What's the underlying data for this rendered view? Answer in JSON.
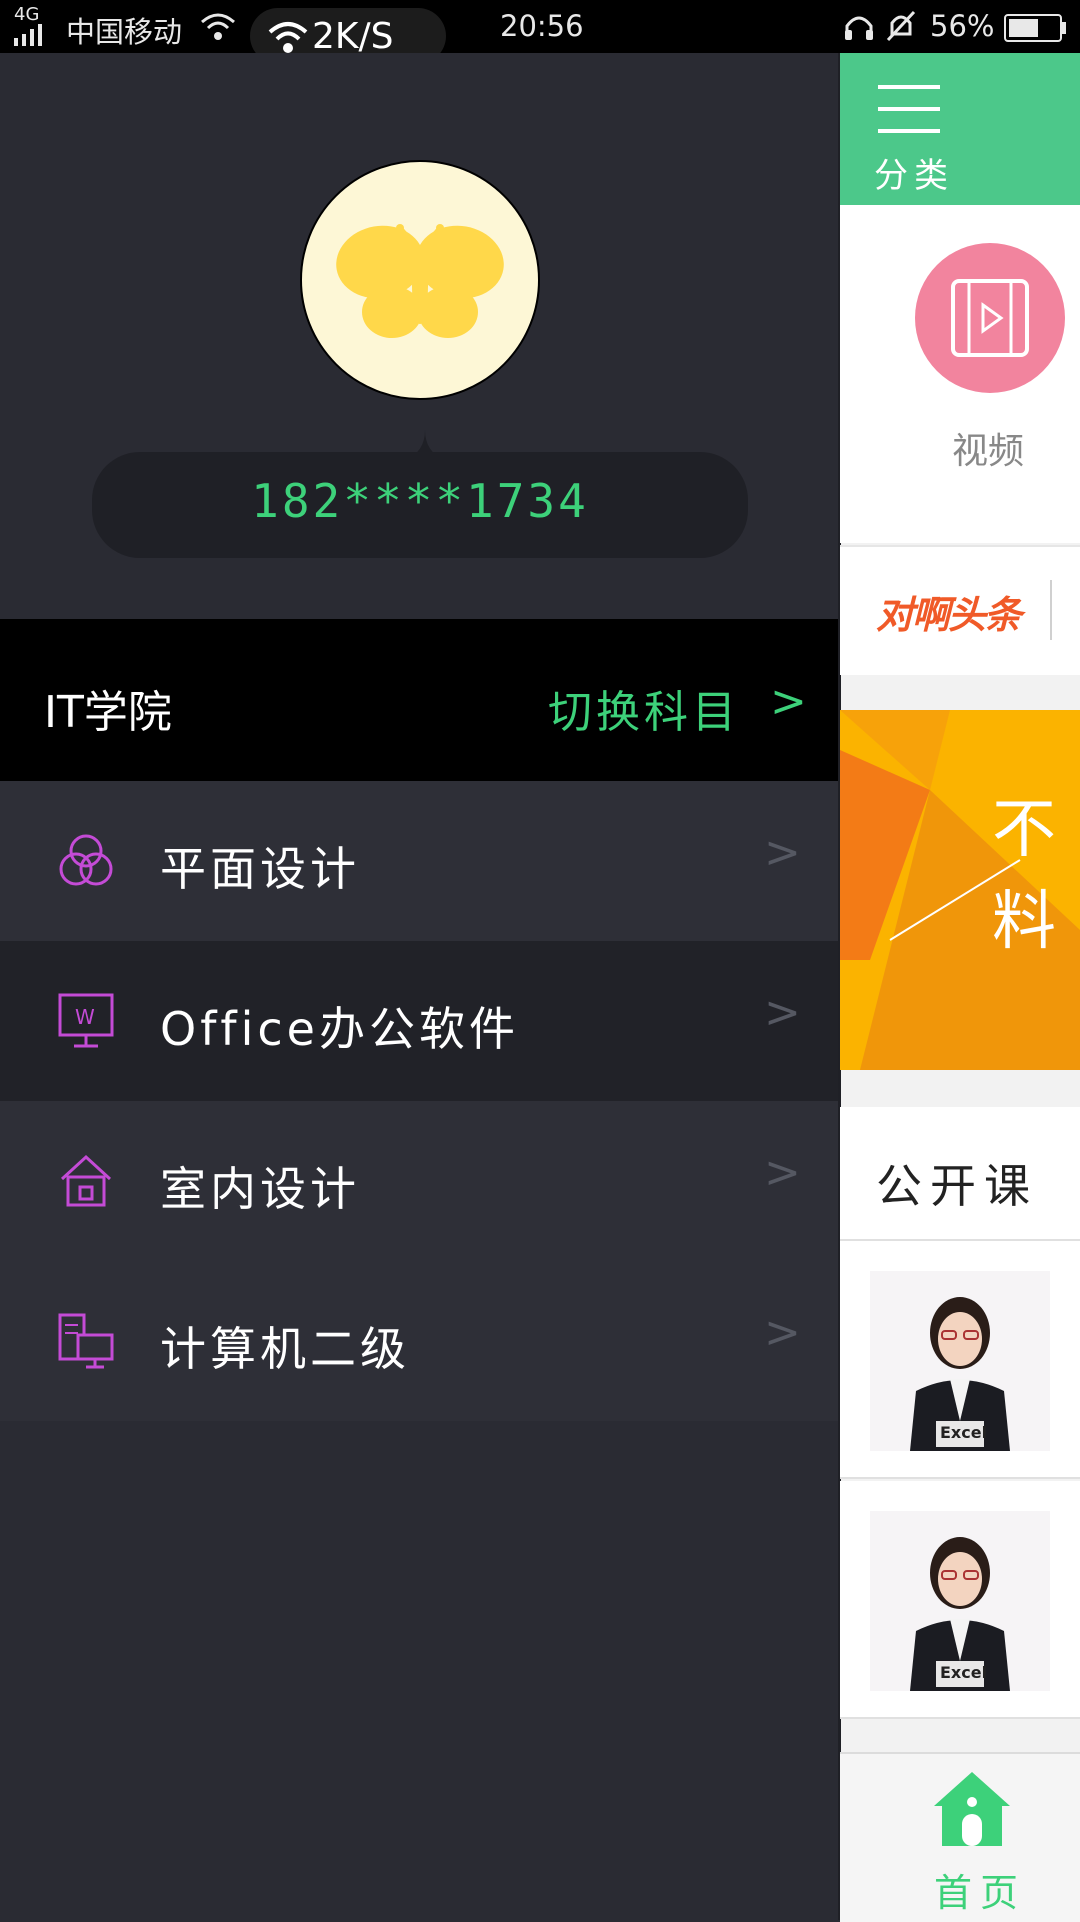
{
  "status_bar": {
    "network_type": "4G",
    "carrier": "中国移动",
    "net_speed": "2K/S",
    "time": "20:56",
    "battery": "56%",
    "battery_level": 0.56
  },
  "profile": {
    "phone": "182****1734"
  },
  "college": {
    "name": "IT学院",
    "switch_label": "切换科目",
    "switch_chevron": ">"
  },
  "menu": [
    {
      "label": "平面设计",
      "icon": "circles-icon"
    },
    {
      "label": "Office办公软件",
      "icon": "monitor-w-icon"
    },
    {
      "label": "室内设计",
      "icon": "house-icon"
    },
    {
      "label": "计算机二级",
      "icon": "computer-icon"
    }
  ],
  "menu_chevron": ">",
  "peek": {
    "category_label": "分类",
    "video_label": "视频",
    "news_logo": "对啊头条",
    "banner_text": "不料",
    "open_course_label": "公开课",
    "home_label": "首页",
    "course_badge": "Excel"
  },
  "colors": {
    "accent_green": "#3dd17a",
    "drawer_bg": "#2a2b33",
    "icon_purple": "#c44bd6",
    "category_green": "#4cc88a",
    "video_pink": "#f2849e",
    "banner_orange": "#fbb300"
  }
}
